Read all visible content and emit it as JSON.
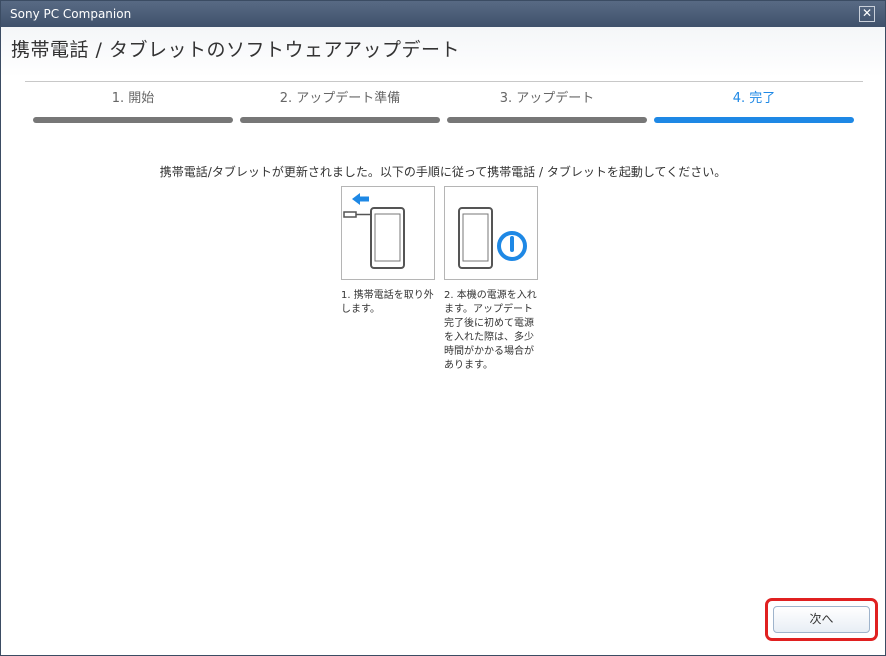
{
  "window": {
    "title": "Sony PC Companion",
    "close_glyph": "✕"
  },
  "header": {
    "title": "携帯電話 / タブレットのソフトウェアアップデート"
  },
  "steps": [
    {
      "label": "1. 開始",
      "active": false
    },
    {
      "label": "2. アップデート準備",
      "active": false
    },
    {
      "label": "3. アップデート",
      "active": false
    },
    {
      "label": "4. 完了",
      "active": true
    }
  ],
  "main": {
    "message": "携帯電話/タブレットが更新されました。以下の手順に従って携帯電話 / タブレットを起動してください。",
    "instructions": [
      {
        "icon": "unplug-phone-icon",
        "caption": "1. 携帯電話を取り外します。"
      },
      {
        "icon": "power-on-icon",
        "caption": "2. 本機の電源を入れます。アップデート完了後に初めて電源を入れた際は、多少時間がかかる場合があります。"
      }
    ]
  },
  "footer": {
    "next_label": "次へ"
  },
  "colors": {
    "accent": "#1e88e5",
    "inactive_bar": "#777777",
    "highlight": "#e02020",
    "titlebar": "#4a5c76"
  }
}
